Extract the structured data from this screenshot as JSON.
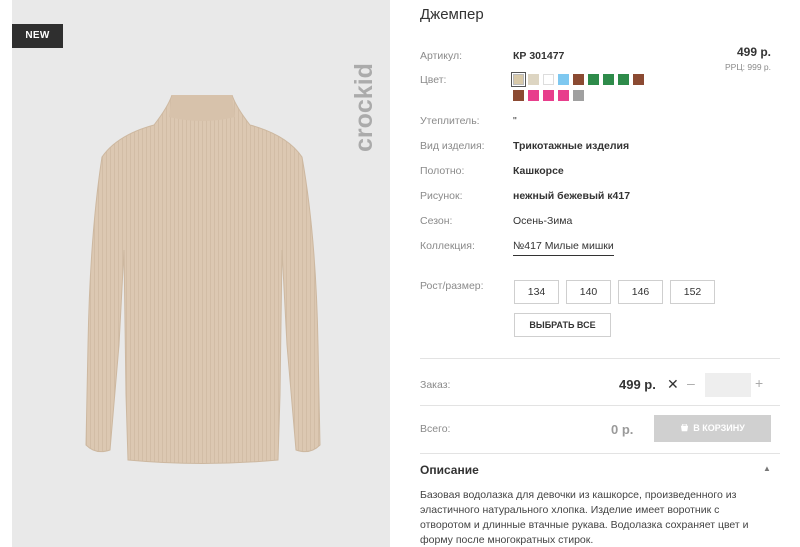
{
  "product": {
    "title": "Джемпер",
    "badge": "NEW",
    "brand_logo": "crockid",
    "price": "499 р.",
    "rrp": "РРЦ: 999 р."
  },
  "attributes": [
    {
      "label": "Артикул:",
      "value": "КР 301477",
      "bold": true
    },
    {
      "label": "Цвет:",
      "value": ""
    },
    {
      "label": "Утеплитель:",
      "value": "\""
    },
    {
      "label": "Вид изделия:",
      "value": "Трикотажные изделия",
      "bold": true
    },
    {
      "label": "Полотно:",
      "value": "Кашкорсе",
      "bold": true
    },
    {
      "label": "Рисунок:",
      "value": "нежный бежевый к417",
      "bold": true
    },
    {
      "label": "Сезон:",
      "value": "Осень-Зима"
    },
    {
      "label": "Коллекция:",
      "value": "№417 Милые мишки",
      "link": true
    }
  ],
  "colors": [
    "#d8c9a9",
    "#ddd5c2",
    "#ffffff",
    "#7ec8f0",
    "#8b4a32",
    "#2e8b4a",
    "#2e8b4a",
    "#2e8b4a",
    "#8b4a32",
    "#8b4a32",
    "#e83e8c",
    "#e83e8c",
    "#e83e8c",
    "#a0a0a0"
  ],
  "sizes": {
    "label": "Рост/размер:",
    "options": [
      "134",
      "140",
      "146",
      "152"
    ],
    "select_all": "ВЫБРАТЬ ВСЕ"
  },
  "order": {
    "label": "Заказ:",
    "price": "499 р.",
    "times": "✕",
    "minus": "–",
    "plus": "+",
    "quantity": ""
  },
  "total": {
    "label": "Всего:",
    "value": "0 р.",
    "cart_button": "В КОРЗИНУ"
  },
  "description": {
    "heading": "Описание",
    "toggle": "▲",
    "text": "Базовая водолазка для девочки из кашкорсе, произведенного из эластичного натурального хлопка. Изделие имеет воротник с отворотом и длинные втачные рукава. Водолазка сохраняет цвет и форму после многократных стирок."
  }
}
